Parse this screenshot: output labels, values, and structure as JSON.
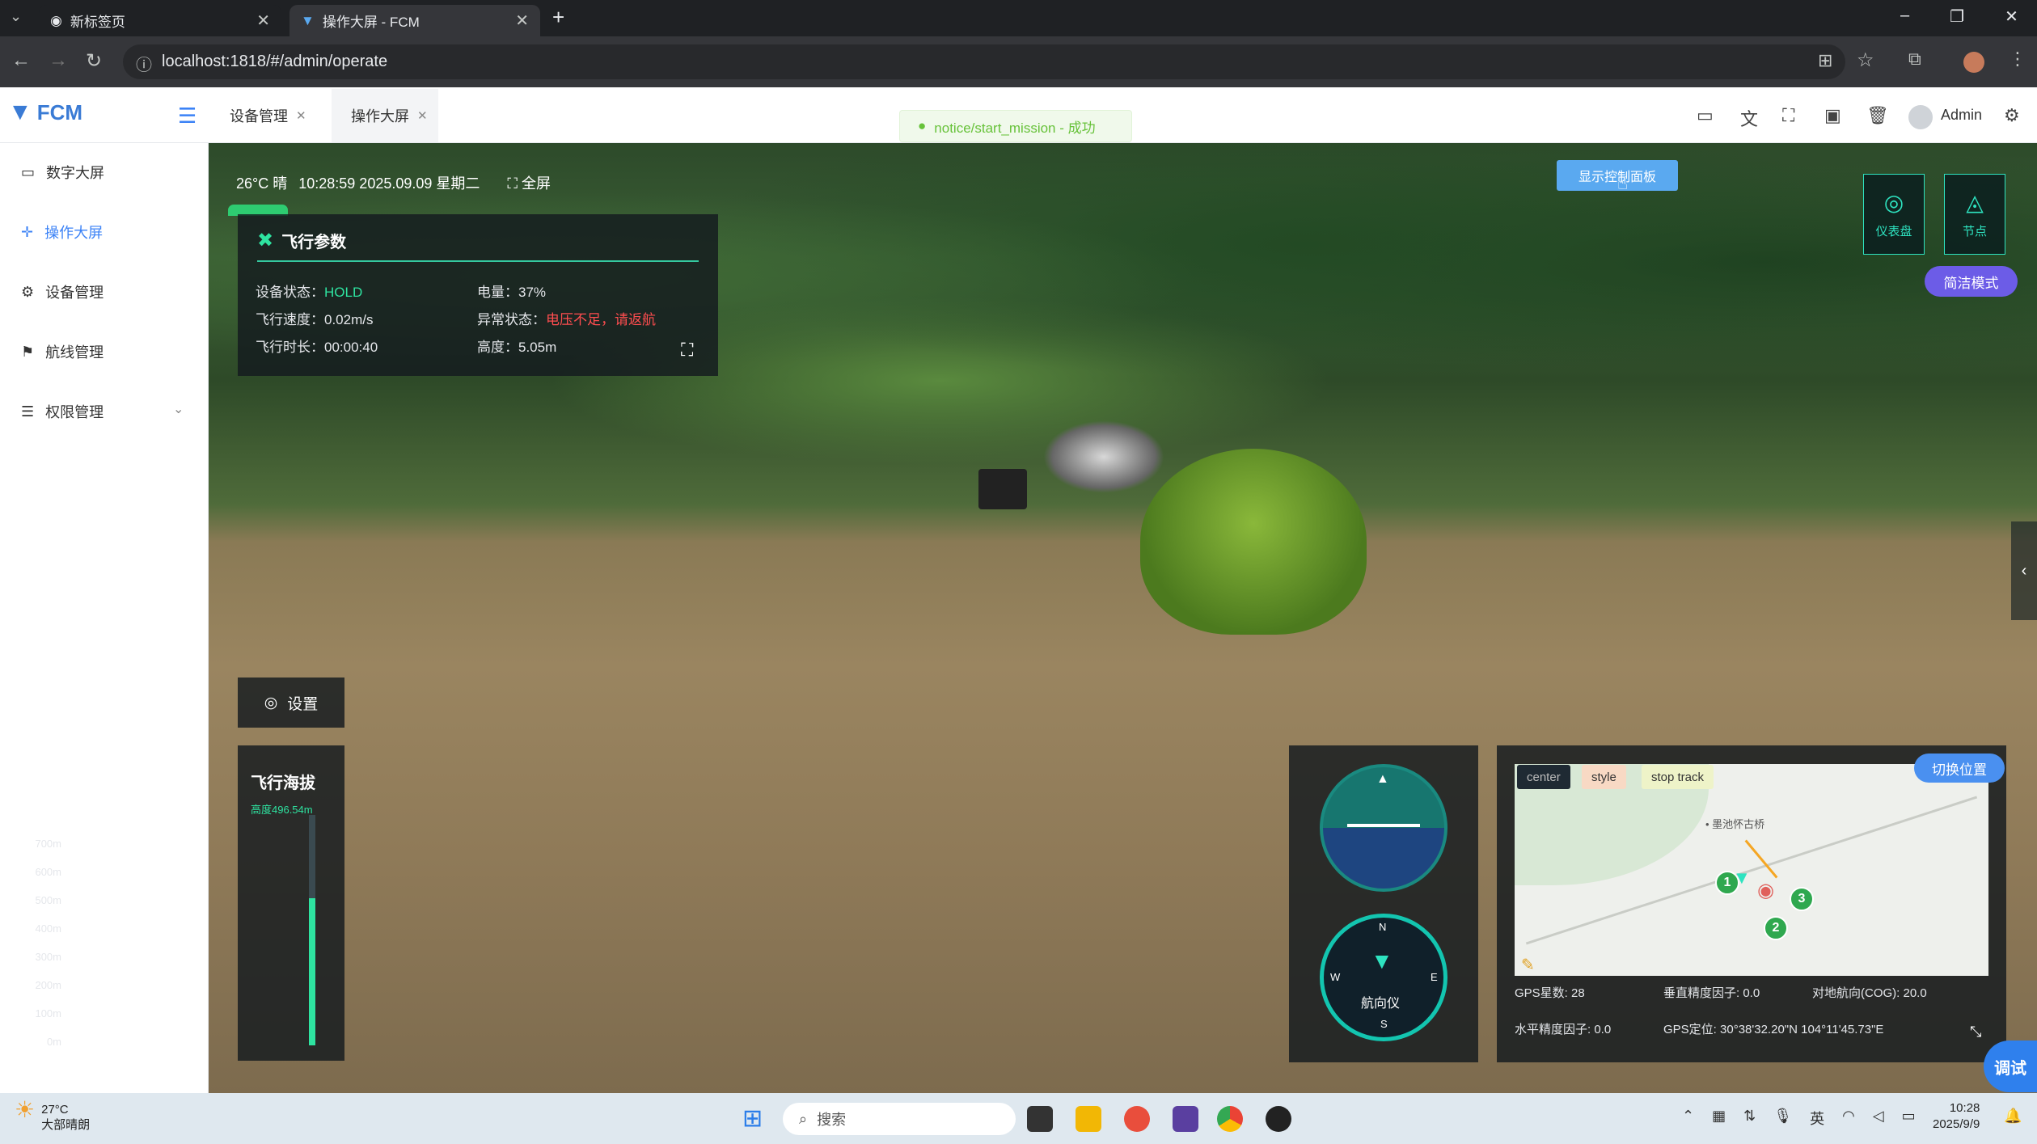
{
  "browser": {
    "tabs": [
      {
        "label": "新标签页"
      },
      {
        "label": "操作大屏 - FCM"
      }
    ],
    "url": "localhost:1818/#/admin/operate"
  },
  "app": {
    "logo": "FCM",
    "tabs": [
      {
        "label": "设备管理"
      },
      {
        "label": "操作大屏"
      }
    ],
    "notice": "notice/start_mission - 成功",
    "user": "Admin"
  },
  "sidebar": {
    "items": [
      {
        "label": "数字大屏",
        "icon": "monitor-icon"
      },
      {
        "label": "操作大屏",
        "icon": "crosshair-icon"
      },
      {
        "label": "设备管理",
        "icon": "gear-icon"
      },
      {
        "label": "航线管理",
        "icon": "flag-icon"
      },
      {
        "label": "权限管理",
        "icon": "sliders-icon"
      }
    ]
  },
  "topinfo": {
    "weather": "26°C 晴",
    "datetime": "10:28:59 2025.09.09 星期二",
    "fullscreen": "全屏"
  },
  "flight": {
    "title": "飞行参数",
    "status_label": "设备状态：",
    "status_value": "HOLD",
    "battery_label": "电量：",
    "battery_value": "37%",
    "speed_label": "飞行速度：",
    "speed_value": "0.02m/s",
    "abnormal_label": "异常状态：",
    "abnormal_value": "电压不足，请返航",
    "duration_label": "飞行时长：",
    "duration_value": "00:00:40",
    "height_label": "高度：",
    "height_value": "5.05m"
  },
  "controls": {
    "show_panel": "显示控制面板",
    "dashboard": "仪表盘",
    "node": "节点",
    "simple_mode": "简洁模式",
    "settings": "设置",
    "switch_position": "切换位置",
    "debug": "调试"
  },
  "altitude": {
    "title": "飞行海拔",
    "sea_level": "高度496.54m",
    "ticks": [
      "700m",
      "600m",
      "500m",
      "400m",
      "300m",
      "200m",
      "100m",
      "0m"
    ],
    "level_fraction": 0.64
  },
  "gauges": {
    "compass_label": "航向仪",
    "north": "N",
    "south": "S",
    "east": "E",
    "west": "W"
  },
  "map": {
    "buttons": [
      "center",
      "style",
      "stop track"
    ],
    "place": "• 墨池怀古桥",
    "markers": [
      "1",
      "2",
      "3"
    ],
    "gps_count_label": "GPS星数: 28",
    "vdop_label": "垂直精度因子: 0.0",
    "cog_label": "对地航向(COG): 20.0",
    "hdop_label": "水平精度因子: 0.0",
    "gps_pos_label": "GPS定位: 30°38'32.20\"N   104°11'45.73\"E"
  },
  "taskbar": {
    "temp": "27°C",
    "weather": "大部晴朗",
    "search": "搜索",
    "time": "10:28",
    "date": "2025/9/9"
  }
}
